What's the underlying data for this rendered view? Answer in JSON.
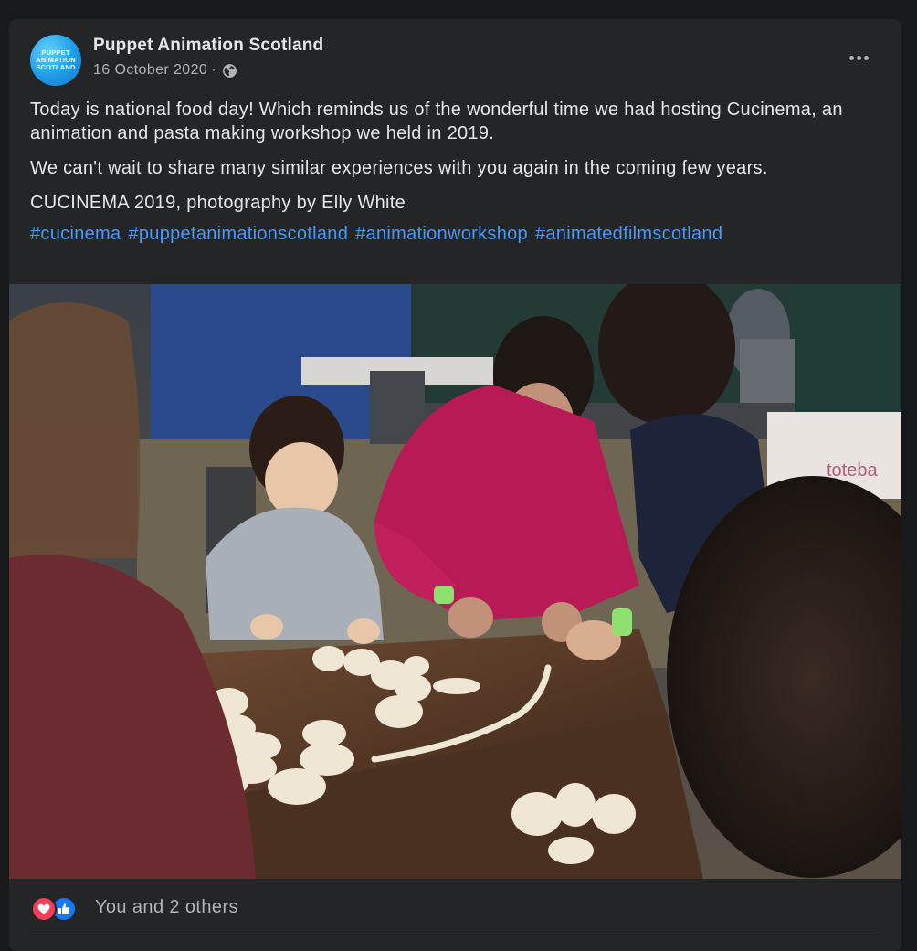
{
  "post": {
    "page_name": "Puppet Animation Scotland",
    "avatar_text": [
      "PUPPET",
      "ANIMATION",
      "SCOTLAND"
    ],
    "date": "16 October 2020",
    "separator": "·",
    "privacy_icon": "globe-icon",
    "menu_icon": "more-options-icon",
    "paragraphs": [
      "Today is national food day! Which reminds us of the wonderful time we had hosting Cucinema, an animation and pasta making workshop we held in 2019.",
      "We can't wait to share many similar experiences with you again in the coming few years."
    ],
    "caption": "CUCINEMA 2019, photography by Elly White",
    "hashtags": [
      "#cucinema",
      "#puppetanimationscotland",
      "#animationworkshop",
      "#animatedfilmscotland"
    ],
    "photo_sign_text": "toteba"
  },
  "reactions": {
    "icons": [
      "love-icon",
      "like-icon"
    ],
    "summary": "You and 2 others"
  },
  "colors": {
    "background": "#18191a",
    "card": "#242526",
    "text_primary": "#e4e6eb",
    "text_secondary": "#b0b3b8",
    "link": "#4599ff",
    "love": "#f33e58",
    "like": "#1877f2"
  }
}
